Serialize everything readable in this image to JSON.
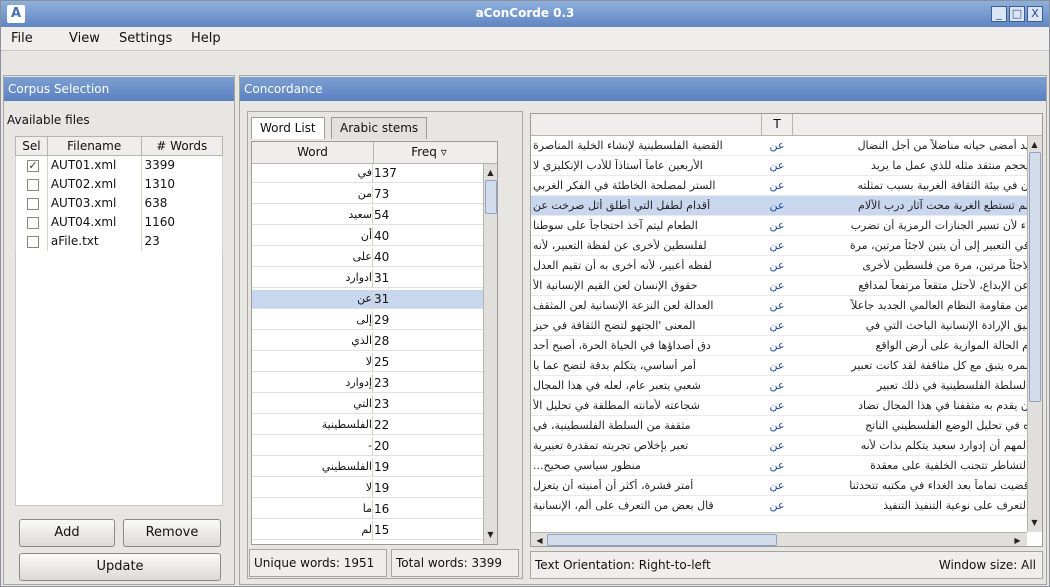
{
  "window": {
    "title": "aConCorde 0.3",
    "minimize": "_",
    "maximize": "□",
    "close": "X",
    "app_icon": "A"
  },
  "menu": [
    "File",
    "View",
    "Settings",
    "Help"
  ],
  "corpus": {
    "header": "Corpus Selection",
    "available_label": "Available files",
    "columns": [
      "Sel",
      "Filename",
      "# Words"
    ],
    "files": [
      {
        "checked": true,
        "name": "AUT01.xml",
        "words": "3399"
      },
      {
        "checked": false,
        "name": "AUT02.xml",
        "words": "1310"
      },
      {
        "checked": false,
        "name": "AUT03.xml",
        "words": "638"
      },
      {
        "checked": false,
        "name": "AUT04.xml",
        "words": "1160"
      },
      {
        "checked": false,
        "name": "aFile.txt",
        "words": "23"
      }
    ],
    "add": "Add",
    "remove": "Remove",
    "update": "Update"
  },
  "concordance": {
    "header": "Concordance",
    "tabs": [
      "Word List",
      "Arabic stems"
    ],
    "word_columns": [
      "Word",
      "Freq ▿"
    ],
    "words": [
      {
        "w": "في",
        "f": "137"
      },
      {
        "w": "من",
        "f": "73"
      },
      {
        "w": "سعيد",
        "f": "54"
      },
      {
        "w": "أن",
        "f": "40"
      },
      {
        "w": "على",
        "f": "40"
      },
      {
        "w": "ادوارد",
        "f": "31"
      },
      {
        "w": "عن",
        "f": "31"
      },
      {
        "w": "إلى",
        "f": "29"
      },
      {
        "w": "الذي",
        "f": "28"
      },
      {
        "w": "لا",
        "f": "25"
      },
      {
        "w": "إدوارد",
        "f": "23"
      },
      {
        "w": "التي",
        "f": "23"
      },
      {
        "w": "الفلسطينية",
        "f": "22"
      },
      {
        "w": "-",
        "f": "20"
      },
      {
        "w": "الفلسطيني",
        "f": "19"
      },
      {
        "w": "لا",
        "f": "19"
      },
      {
        "w": "ما",
        "f": "16"
      },
      {
        "w": "لم",
        "f": "15"
      }
    ],
    "selected_word_index": 6,
    "unique_words": "Unique words: 1951",
    "total_words": "Total words: 3399",
    "t_column": "T",
    "keyword": "عن",
    "lines": [
      {
        "l": "القضية الفلسطينية لإنشاء الخلية المناصرة",
        "r": "يد أمضى حياته مناضلاً من أجل النضال"
      },
      {
        "l": "الأربعين عاماً أستاذاً للأدب الإنكليزي لا",
        "r": "يحجم منتقد مثله للذي عمل ما يريد"
      },
      {
        "l": "الستر لمصلحة الخاطئة في الفكر الغربي",
        "r": "ن في بيئة الثقافة الغربية بسبب تمثلته"
      },
      {
        "l": "أقدام لطفل التي أطلق أثل صرخت عن",
        "r": "لم تستطع الغربة محت آثار درب الآلام"
      },
      {
        "l": "الطعام ليتم آخذ احتجاجاً على سوطنا",
        "r": "اء لأن تسير الجنازات الرمزية أن تضرب"
      },
      {
        "l": "لفلسطين لأخرى عن لفظة التعبير، لأنه",
        "r": "في التعبير إلى أن يتين لاجئاً مرتين، مرة"
      },
      {
        "l": "لفظه أعبير، لأنه أخرى به أن تقيم العدل",
        "r": "لاجئاً مرتين، مرة من فلسطين لأخرى"
      },
      {
        "l": "حقوق الإنسان لعن القيم الإنسانية الأ",
        "r": "عن الإبداع، لأحتل متقعاً مرتفعاً لمدافع"
      },
      {
        "l": "العدالة لعن النزعة الإنسانية لعن المثقف",
        "r": "من مقاومة النظام العالمي الجديد جاعلاً"
      },
      {
        "l": "المعنى 'الجتهو لتضح الثقافة في حيز",
        "r": "بيق الإرادة الإنسانية الباحث التي في"
      },
      {
        "l": "دق أصداؤها في الحياة الحرة، أصبح أحد",
        "r": "م الحالة الموازية على أرض الواقع"
      },
      {
        "l": "أمر أساسي، يتكلم بدقة لتضح عما يا",
        "r": "لمره يتبق مع كل مثاقفة لقد كانت تعبير"
      },
      {
        "l": "شعبي يتعبر عام، لعله في هذا المجال",
        "r": "السلطة الفلسطينية في ذلك تعبير"
      },
      {
        "l": "شجاعته لأمانته المطلقة في تحليل الأ",
        "r": "ن يقدم به مثقفنا في هذا المجال تضاد"
      },
      {
        "l": "مثقفة من السلطة الفلسطينية، في",
        "r": "ه في تحليل الوضع الفلسطيني الناتج"
      },
      {
        "l": "تعبر بإخلاص تجربته تمقدرة تعبيرية",
        "r": "المهم أن إدوارد سعيد يتكلم بذات لأنه"
      },
      {
        "l": "منظور سياسي صحيح...",
        "r": "التشاطر تتجنب الخلفية على معقدة"
      },
      {
        "l": "أمتر فشرة، أكثر أن أمنيته أن يتعزل",
        "r": "قضيت تماماً بعد الغداء في مكتبه تتحدثنا"
      },
      {
        "l": "قال بعض من التعرف على ألم، الإنسانية",
        "r": "التعرف على نوعية التنفيذ التنفيذ"
      }
    ],
    "text_orientation": "Text Orientation: Right-to-left",
    "window_size": "Window size: All"
  }
}
